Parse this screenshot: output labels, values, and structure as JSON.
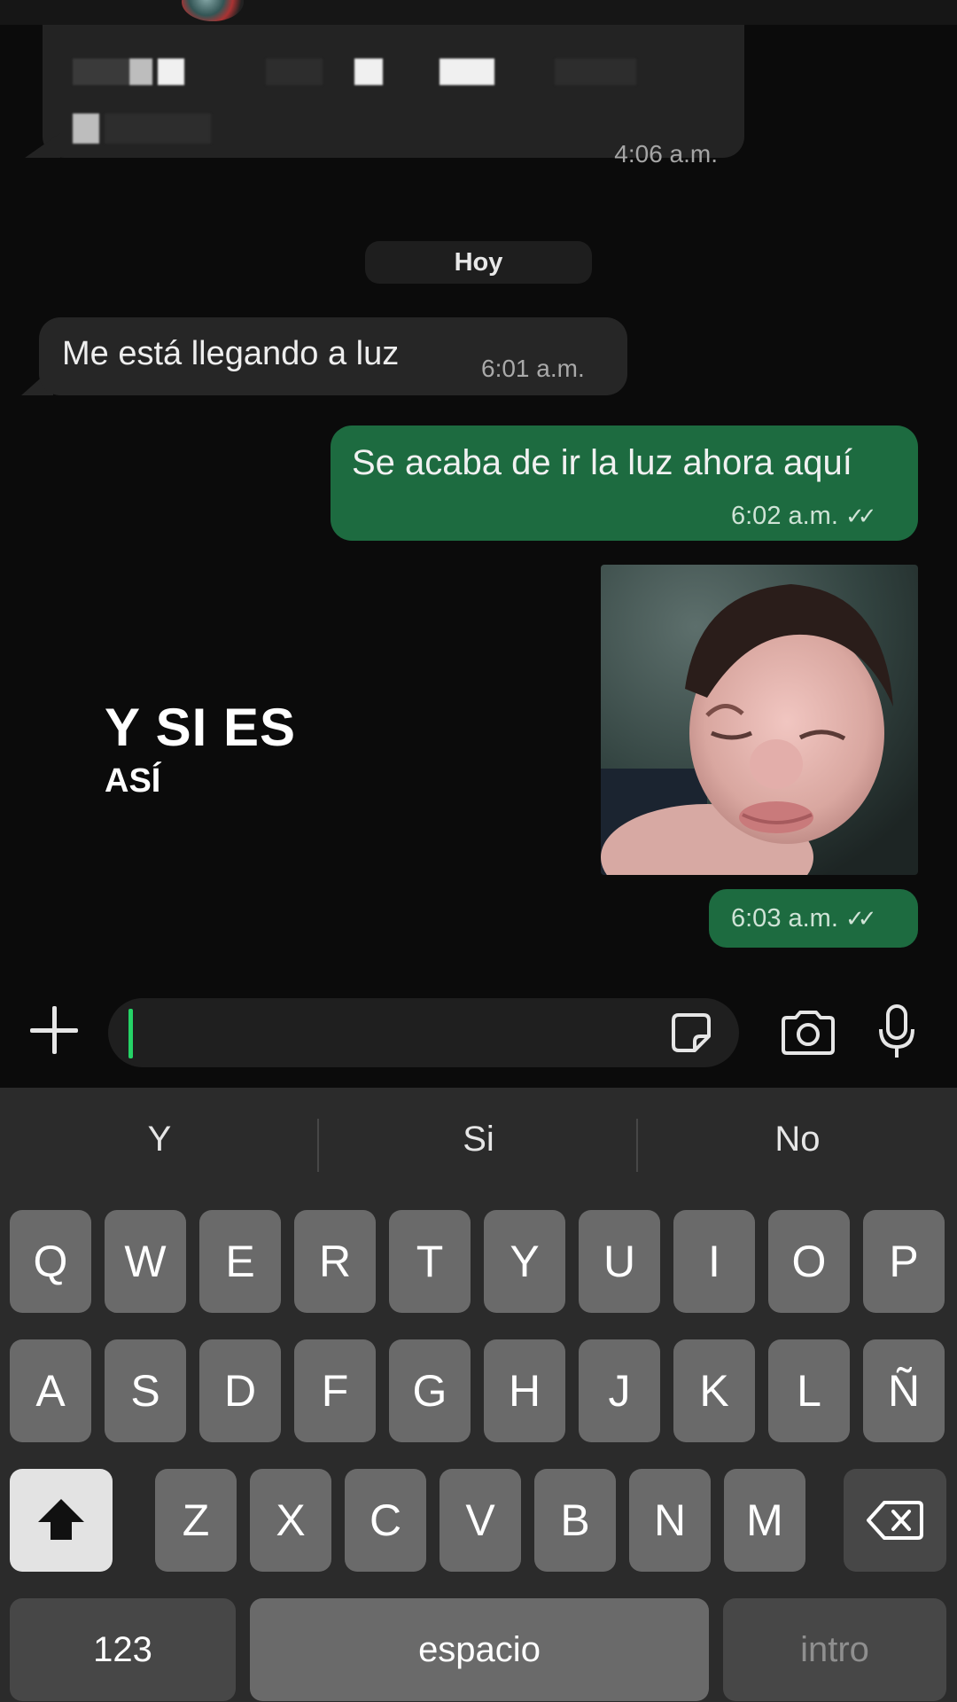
{
  "chat": {
    "old_message": {
      "time": "4:06 a.m."
    },
    "date_chip": "Hoy",
    "incoming": {
      "text": "Me está llegando a luz",
      "time": "6:01 a.m."
    },
    "outgoing": {
      "text": "Se acaba de ir la luz ahora aquí",
      "time": "6:02 a.m.",
      "ticks": "✓✓"
    },
    "image_message": {
      "time": "6:03 a.m.",
      "ticks": "✓✓"
    }
  },
  "overlay": {
    "line1": "Y SI ES",
    "line2": "ASÍ"
  },
  "compose": {
    "placeholder": ""
  },
  "keyboard": {
    "suggestions": [
      "Y",
      "Si",
      "No"
    ],
    "row1": [
      "Q",
      "W",
      "E",
      "R",
      "T",
      "Y",
      "U",
      "I",
      "O",
      "P"
    ],
    "row2": [
      "A",
      "S",
      "D",
      "F",
      "G",
      "H",
      "J",
      "K",
      "L",
      "Ñ"
    ],
    "row3": [
      "Z",
      "X",
      "C",
      "V",
      "B",
      "N",
      "M"
    ],
    "numbers_label": "123",
    "space_label": "espacio",
    "return_label": "intro"
  },
  "colors": {
    "background": "#0b0b0b",
    "incoming_bubble": "#262626",
    "outgoing_bubble": "#1d6b40",
    "cursor": "#25d366",
    "key": "#6a6a6a",
    "key_system": "#474747"
  }
}
